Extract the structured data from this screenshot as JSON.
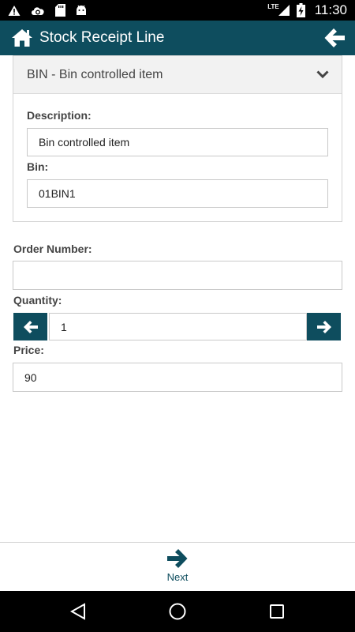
{
  "status_bar": {
    "time": "11:30",
    "network": "LTE",
    "left_icons": [
      "warning-icon",
      "cloud-sync-icon",
      "sd-card-icon",
      "android-icon"
    ],
    "right_icons": [
      "signal-icon",
      "battery-charging-icon"
    ]
  },
  "app_bar": {
    "title": "Stock Receipt Line",
    "home_icon": "home-icon",
    "back_icon": "arrow-left-icon",
    "background": "#0e4d5e"
  },
  "bin_section": {
    "header": "BIN - Bin controlled item",
    "description_label": "Description:",
    "description_value": "Bin controlled item",
    "bin_label": "Bin:",
    "bin_value": "01BIN1"
  },
  "order": {
    "label": "Order Number:",
    "value": ""
  },
  "quantity": {
    "label": "Quantity:",
    "value": "1"
  },
  "price": {
    "label": "Price:",
    "value": "90"
  },
  "footer": {
    "next_label": "Next"
  },
  "nav": [
    "back-triangle-icon",
    "home-circle-icon",
    "recents-square-icon"
  ]
}
